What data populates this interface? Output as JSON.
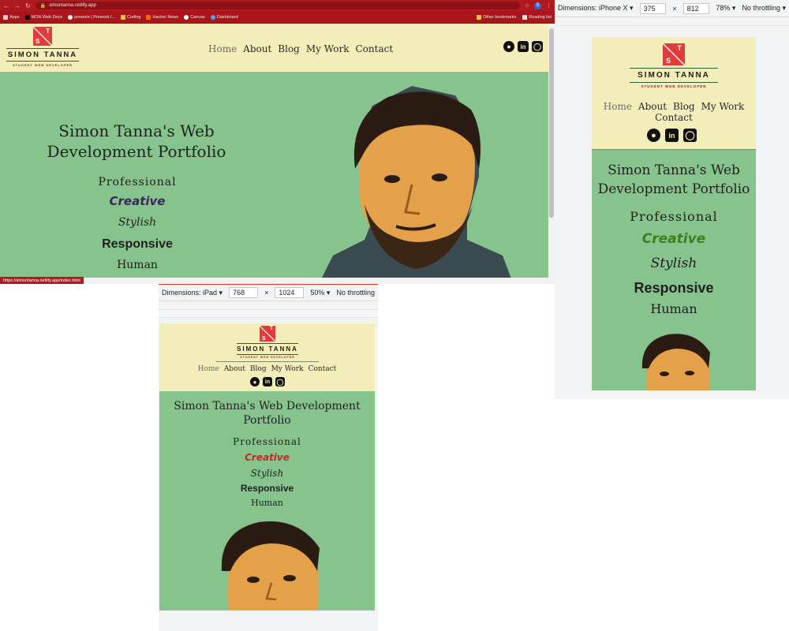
{
  "desktop": {
    "address": "simontanna.netlify.app",
    "bookmarks": [
      "Apps",
      "MON Web Docs",
      "prework | Prework I...",
      "Coding",
      "Hacker News",
      "Canvas",
      "Dashboard"
    ],
    "bookmarks_right": [
      "Other bookmarks",
      "Reading list"
    ],
    "profile_initial": "S",
    "status_url": "https://simontanna.netlify.app/index.html"
  },
  "site": {
    "logo": {
      "letters": [
        "T",
        "S"
      ],
      "name": "SIMON TANNA",
      "tagline": "STUDENT WEB DEVELOPER"
    },
    "nav": [
      "Home",
      "About",
      "Blog",
      "My Work",
      "Contact"
    ],
    "active_nav": "Home",
    "social_icons": [
      "github-icon",
      "linkedin-icon",
      "instagram-icon"
    ],
    "hero_title": "Simon Tanna's Web Development Portfolio",
    "words": [
      "Professional",
      "Creative",
      "Stylish",
      "Responsive",
      "Human"
    ],
    "colors": {
      "header_bg": "#f3edb9",
      "hero_bg": "#87c38c",
      "logo_red": "#e23b3b",
      "chrome_red": "#b0191e"
    }
  },
  "iphone": {
    "device_label": "Dimensions: iPhone X ▾",
    "width": "375",
    "height": "812",
    "zoom": "78% ▾",
    "throttle": "No throttling ▾",
    "creative_color": "#3f7d1f"
  },
  "ipad": {
    "device_label": "Dimensions: iPad ▾",
    "width": "768",
    "height": "1024",
    "zoom": "50% ▾",
    "throttle": "No throttling",
    "creative_color": "#c0282c"
  },
  "desktop_creative_color": "#3b2560"
}
